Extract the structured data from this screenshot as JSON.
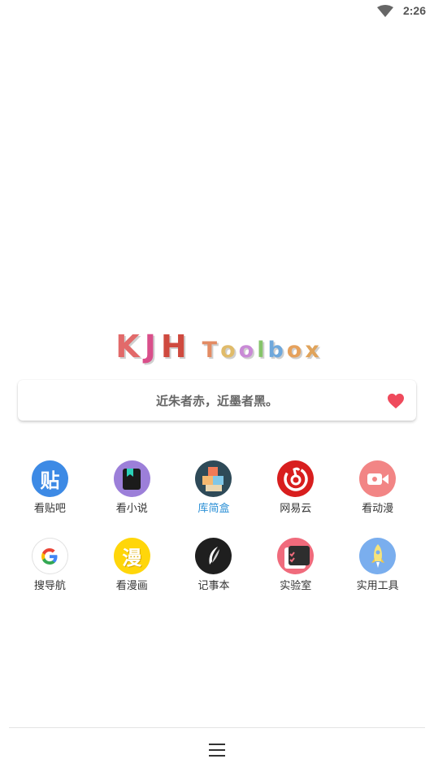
{
  "status": {
    "time": "2:26"
  },
  "logo": {
    "letters": [
      {
        "ch": "K",
        "color": "#e26a6a",
        "size": "big"
      },
      {
        "ch": "J",
        "color": "#d94f8a",
        "size": "big"
      },
      {
        "ch": "H",
        "color": "#cf4a3f",
        "size": "big"
      },
      {
        "ch": "T",
        "color": "#e38b63",
        "size": "small"
      },
      {
        "ch": "o",
        "color": "#e0bb6a",
        "size": "small"
      },
      {
        "ch": "o",
        "color": "#c98ad6",
        "size": "small"
      },
      {
        "ch": "l",
        "color": "#85c46a",
        "size": "small"
      },
      {
        "ch": "b",
        "color": "#6fa8dc",
        "size": "small"
      },
      {
        "ch": "o",
        "color": "#e6a15c",
        "size": "small"
      },
      {
        "ch": "x",
        "color": "#e0a35a",
        "size": "small"
      }
    ]
  },
  "quote": {
    "text": "近朱者赤，近墨者黑。",
    "heart_color": "#ef4a5c"
  },
  "apps": [
    [
      {
        "label": "看贴吧",
        "icon": "tieba-icon",
        "bg": "#3d8ae5",
        "glyph": "贴"
      },
      {
        "label": "看小说",
        "icon": "novel-icon",
        "bg": "#9c7fd9",
        "glyph": ""
      },
      {
        "label": "库简盒",
        "icon": "toolbox-icon",
        "bg": "#2e4a58",
        "glyph": "",
        "active": true
      },
      {
        "label": "网易云",
        "icon": "netease-music-icon",
        "bg": "#d81e1e",
        "glyph": ""
      },
      {
        "label": "看动漫",
        "icon": "video-camera-icon",
        "bg": "#f28585",
        "glyph": ""
      }
    ],
    [
      {
        "label": "搜导航",
        "icon": "google-icon",
        "bg": "#ffffff",
        "glyph": "G"
      },
      {
        "label": "看漫画",
        "icon": "comic-icon",
        "bg": "#ffd60a",
        "glyph": "漫"
      },
      {
        "label": "记事本",
        "icon": "notebook-feather-icon",
        "bg": "#1f1f1f",
        "glyph": ""
      },
      {
        "label": "实验室",
        "icon": "lab-checklist-icon",
        "bg": "#f06b7c",
        "glyph": ""
      },
      {
        "label": "实用工具",
        "icon": "rocket-icon",
        "bg": "#7aaeee",
        "glyph": ""
      }
    ]
  ]
}
